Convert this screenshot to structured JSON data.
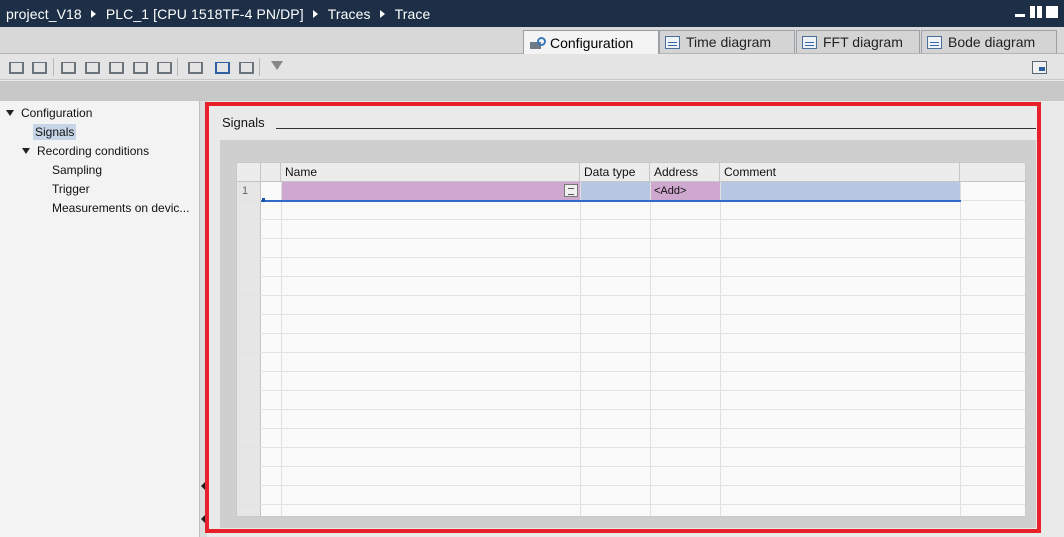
{
  "breadcrumb": [
    "project_V18",
    "PLC_1 [CPU 1518TF-4 PN/DP]",
    "Traces",
    "Trace"
  ],
  "tabs": [
    {
      "label": "Configuration",
      "icon": "configuration-icon",
      "active": true
    },
    {
      "label": "Time diagram",
      "icon": "time-diagram-icon",
      "active": false
    },
    {
      "label": "FFT diagram",
      "icon": "fft-diagram-icon",
      "active": false
    },
    {
      "label": "Bode diagram",
      "icon": "bode-diagram-icon",
      "active": false
    }
  ],
  "toolbar_icons": [
    "install-trace-icon",
    "upload-trace-icon",
    "add-signal-icon",
    "add-signal-alt-icon",
    "copy-signal-icon",
    "delete-signal-icon",
    "refresh-icon",
    "import-icon",
    "transfer-to-device-icon",
    "export-icon",
    "filter-icon",
    "inspector-icon"
  ],
  "navtree": {
    "items": [
      {
        "label": "Configuration"
      },
      {
        "label": "Signals"
      },
      {
        "label": "Recording conditions"
      },
      {
        "label": "Sampling"
      },
      {
        "label": "Trigger"
      },
      {
        "label": "Measurements on devic..."
      }
    ]
  },
  "section": {
    "title": "Signals"
  },
  "table": {
    "columns": [
      "Name",
      "Data type",
      "Address",
      "Comment"
    ],
    "rows": [
      {
        "num": "1",
        "name": "",
        "data_type": "",
        "address": "<Add>",
        "comment": ""
      }
    ]
  },
  "colors": {
    "highlight_frame": "#e8202a",
    "titlebar": "#1c2f46",
    "name_cell": "#cfa8cf",
    "row_cell": "#b6c6e3"
  }
}
